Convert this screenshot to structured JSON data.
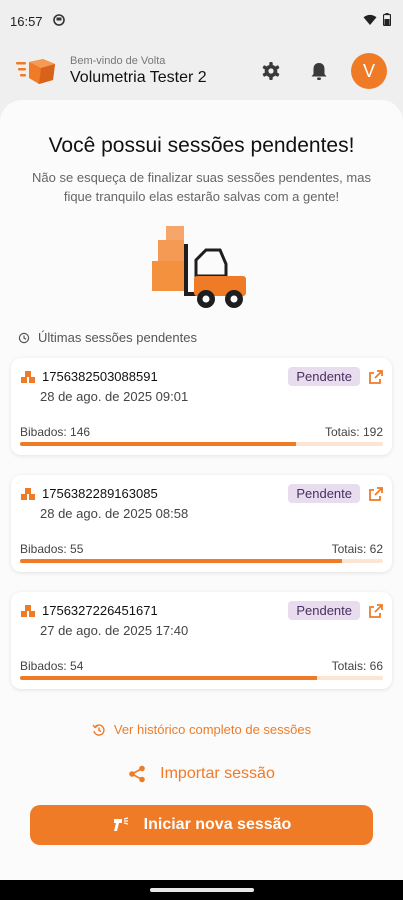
{
  "status_bar": {
    "time": "16:57"
  },
  "header": {
    "greeting": "Bem-vindo de Volta",
    "user_name": "Volumetria Tester 2",
    "avatar_initial": "V"
  },
  "main": {
    "title": "Você possui sessões pendentes!",
    "subtitle": "Não se esqueça de finalizar suas sessões pendentes, mas fique tranquilo elas estarão salvas com a gente!",
    "section_label": "Últimas sessões pendentes",
    "sessions": [
      {
        "id": "1756382503088591",
        "date": "28 de ago. de 2025 09:01",
        "status": "Pendente",
        "bipados_label": "Bibados: 146",
        "totais_label": "Totais: 192",
        "progress": 0.76
      },
      {
        "id": "1756382289163085",
        "date": "28 de ago. de 2025 08:58",
        "status": "Pendente",
        "bipados_label": "Bibados: 55",
        "totais_label": "Totais: 62",
        "progress": 0.887
      },
      {
        "id": "1756327226451671",
        "date": "27 de ago. de 2025 17:40",
        "status": "Pendente",
        "bipados_label": "Bibados: 54",
        "totais_label": "Totais: 66",
        "progress": 0.818
      }
    ]
  },
  "actions": {
    "history_link": "Ver histórico completo de sessões",
    "import_label": "Importar sessão",
    "start_label": "Iniciar nova sessão"
  },
  "colors": {
    "accent": "#f07b27",
    "badge_bg": "#e8dcef",
    "badge_text": "#4a2f5f"
  }
}
